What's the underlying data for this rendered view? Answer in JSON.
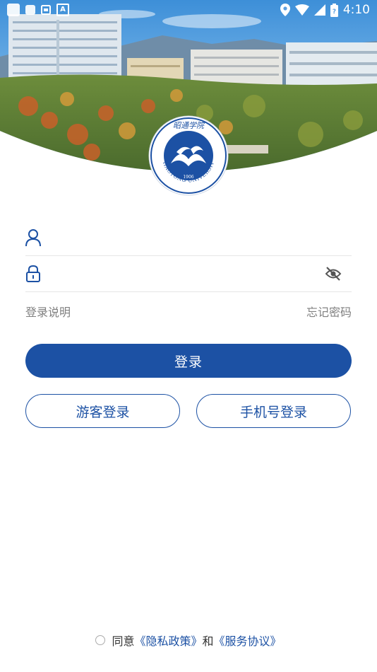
{
  "status_bar": {
    "time": "4:10",
    "icons": [
      "notification-box-icon",
      "notification-box-icon",
      "sim-card-icon",
      "a-icon",
      "location-icon",
      "wifi-icon",
      "signal-icon",
      "battery-icon"
    ]
  },
  "header": {
    "logo": {
      "arc_text": "ZHAOTONG UNIVERSITY",
      "year": "1906",
      "calligraphy": "昭通学院"
    }
  },
  "form": {
    "username": {
      "icon": "user-icon",
      "value": "",
      "placeholder": ""
    },
    "password": {
      "icon": "lock-icon",
      "value": "",
      "placeholder": "",
      "toggle_icon": "eye-off-icon"
    },
    "login_help_label": "登录说明",
    "forgot_password_label": "忘记密码",
    "login_button_label": "登录",
    "guest_login_label": "游客登录",
    "phone_login_label": "手机号登录"
  },
  "agreement": {
    "agree_text": "同意",
    "privacy_link": "《隐私政策》",
    "and_text": "和",
    "service_link": "《服务协议》"
  },
  "colors": {
    "primary": "#1c51a4",
    "muted_text": "#808080",
    "divider": "#e6e6e6"
  }
}
